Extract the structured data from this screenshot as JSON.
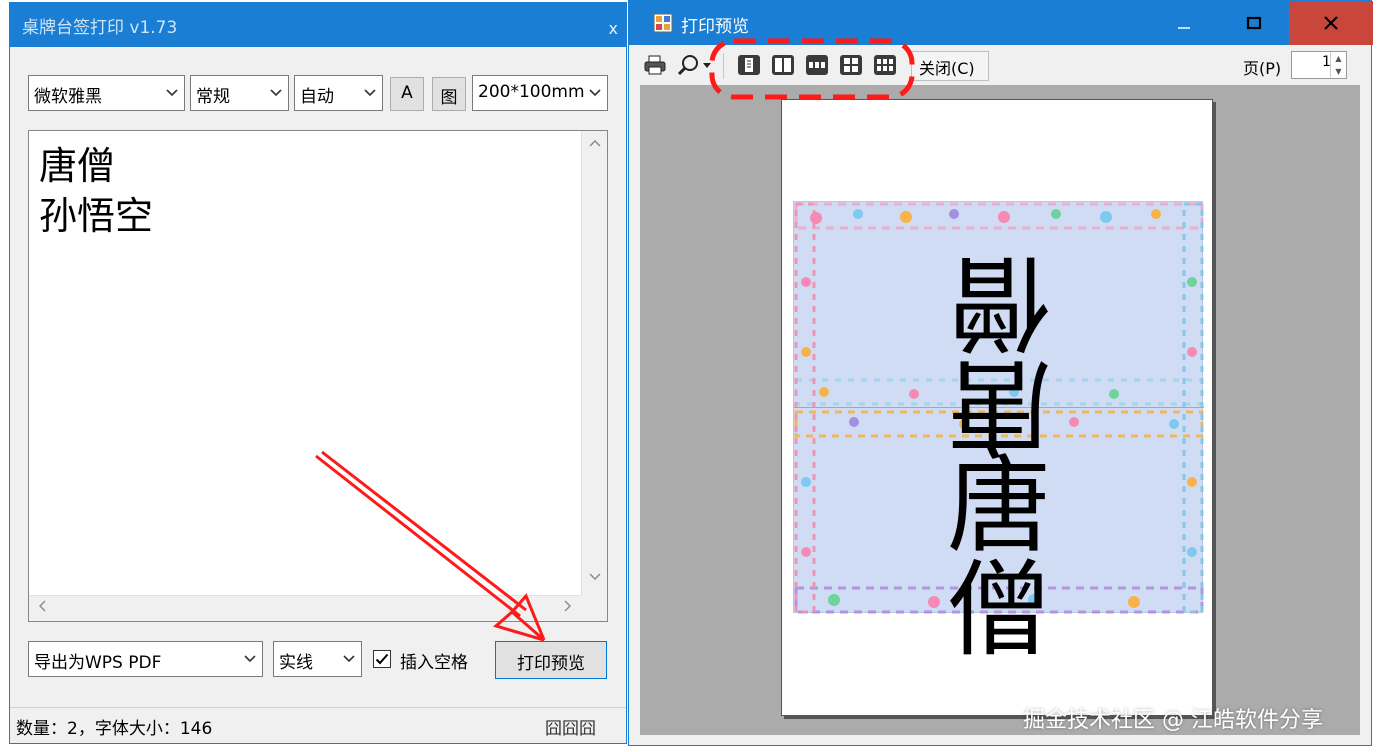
{
  "left_window": {
    "title": "桌牌台签打印 v1.73",
    "close_label": "x",
    "font_select": "微软雅黑",
    "style_select": "常规",
    "size_select": "自动",
    "btn_font_a": "A",
    "btn_image": "图",
    "paper_select": "200*100mm",
    "text_lines": [
      "唐僧",
      "孙悟空"
    ],
    "export_select": "导出为WPS PDF",
    "line_select": "实线",
    "insert_space_label": "插入空格",
    "insert_space_checked": true,
    "print_preview_button": "打印预览",
    "status_text": "数量：2，字体大小：146",
    "status_right": "囧囧囧"
  },
  "right_window": {
    "title": "打印预览",
    "minimize_label": "—",
    "maximize_label": "▢",
    "close_label": "x",
    "toolbar": {
      "print_icon": "printer-icon",
      "zoom_icon": "magnifier-icon",
      "layout_icons": [
        "one-page-icon",
        "two-pages-icon",
        "three-pages-icon",
        "four-pages-icon",
        "six-pages-icon"
      ],
      "close_button": "关闭(C)",
      "page_label": "页(P)",
      "page_value": "1"
    },
    "preview": {
      "card_top_name": "唐僧",
      "card_bottom_name": "唐僧"
    }
  },
  "watermark": "掘金技术社区 @ 江皓软件分享",
  "colors": {
    "titlebar": "#1a7fd4",
    "close_hover": "#c8463c",
    "card_bg": "#cfdcf3",
    "annotation_red": "#ff1a1a"
  }
}
